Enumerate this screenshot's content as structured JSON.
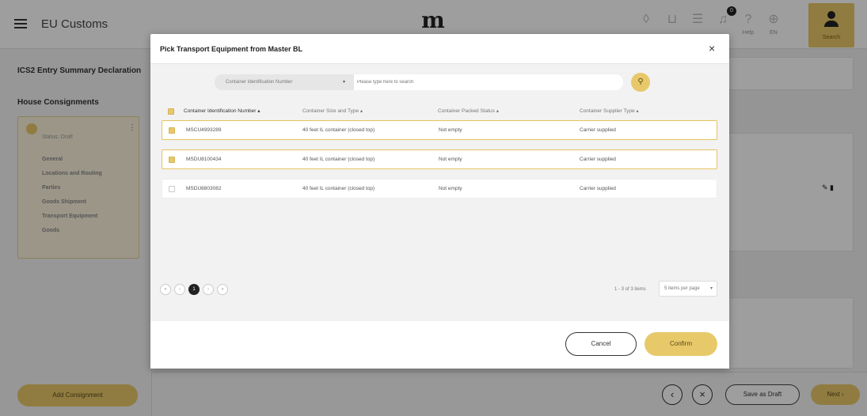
{
  "app": {
    "title": "EU Customs",
    "logo": "m",
    "top_icons": [
      {
        "icon": "drop-icon",
        "label": ""
      },
      {
        "icon": "cart-icon",
        "label": ""
      },
      {
        "icon": "list-icon",
        "label": ""
      },
      {
        "icon": "bell-icon",
        "label": "",
        "badge": "0"
      },
      {
        "icon": "help-icon",
        "label": "Help"
      },
      {
        "icon": "globe-icon",
        "label": "EN"
      }
    ],
    "user_label": "Search"
  },
  "sidebar": {
    "declaration_title": "ICS2 Entry Summary Declaration",
    "consignments_title": "House Consignments",
    "status": "Status: Draft",
    "links": [
      "General",
      "Locations and Routing",
      "Parties",
      "Goods Shipment",
      "Transport Equipment",
      "Goods"
    ],
    "add_button": "Add Consignment"
  },
  "footer": {
    "save_draft": "Save as Draft",
    "next": "Next ›",
    "prev_icon": "‹",
    "close_icon": "×"
  },
  "modal": {
    "title": "Pick Transport Equipment from Master BL",
    "close": "×",
    "search": {
      "field": "Container Identification Number",
      "placeholder": "Please type here to search"
    },
    "columns": [
      "Container Identification Number",
      "Container Size and Type",
      "Container Packed Status",
      "Container Supplier Type"
    ],
    "rows": [
      {
        "id": "MSCU4993289",
        "size_type": "40 feet IL container (closed top)",
        "packed": "Not empty",
        "supplier": "Carrier supplied",
        "checked": true
      },
      {
        "id": "MSDU8100434",
        "size_type": "40 feet IL container (closed top)",
        "packed": "Not empty",
        "supplier": "Carrier supplied",
        "checked": true
      },
      {
        "id": "MSDU8803082",
        "size_type": "40 feet IL container (closed top)",
        "packed": "Not empty",
        "supplier": "Carrier supplied",
        "checked": false
      }
    ],
    "pagination": {
      "buttons": [
        "«",
        "‹",
        "1",
        "›",
        "»"
      ],
      "current": "1",
      "info": "1 - 3 of 3 items",
      "per_page": "5 items per page"
    },
    "cancel": "Cancel",
    "confirm": "Confirm"
  },
  "colors": {
    "accent": "#e8c96a",
    "selected_border": "#e5c35f",
    "overlay": "rgba(0,0,0,0.38)"
  }
}
